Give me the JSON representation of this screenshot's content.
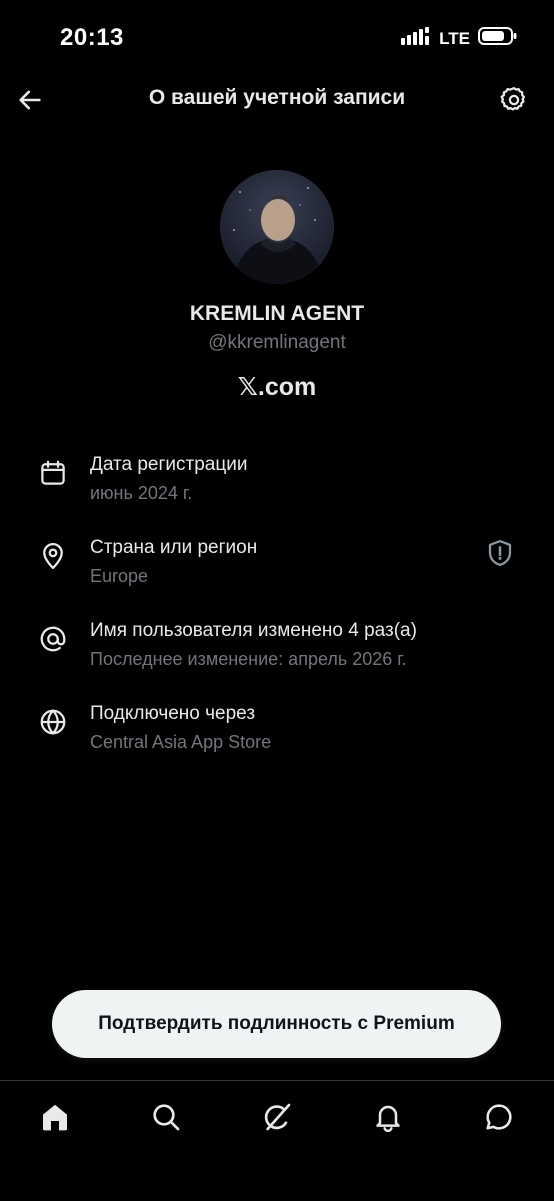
{
  "status_bar": {
    "time": "20:13",
    "network": "LTE",
    "battery_icon": "battery-icon",
    "signal_icon": "signal-icon"
  },
  "header": {
    "title": "О вашей учетной записи",
    "back_icon": "arrow-left-icon",
    "settings_icon": "gear-icon"
  },
  "profile": {
    "display_name": "KREMLIN AGENT",
    "handle": "@kkremlinagent",
    "site": "𝕏.com"
  },
  "info": [
    {
      "icon": "calendar-icon",
      "title": "Дата регистрации",
      "subtitle": "июнь 2024 г."
    },
    {
      "icon": "location-pin-icon",
      "title": "Страна или регион",
      "subtitle": "Europe",
      "badge_icon": "shield-alert-icon"
    },
    {
      "icon": "at-sign-icon",
      "title": "Имя пользователя изменено 4 раз(а)",
      "subtitle": "Последнее изменение: апрель 2026 г."
    },
    {
      "icon": "globe-icon",
      "title": "Подключено через",
      "subtitle": "Central Asia App Store"
    }
  ],
  "premium_button": {
    "label": "Подтвердить подлинность с Premium"
  },
  "bottom_nav": [
    "home-icon",
    "search-icon",
    "grok-icon",
    "bell-icon",
    "chat-icon"
  ],
  "colors": {
    "background": "#000000",
    "primary_text": "#e7e9ea",
    "secondary_text": "#71767b",
    "button_bg": "#eff3f4"
  }
}
